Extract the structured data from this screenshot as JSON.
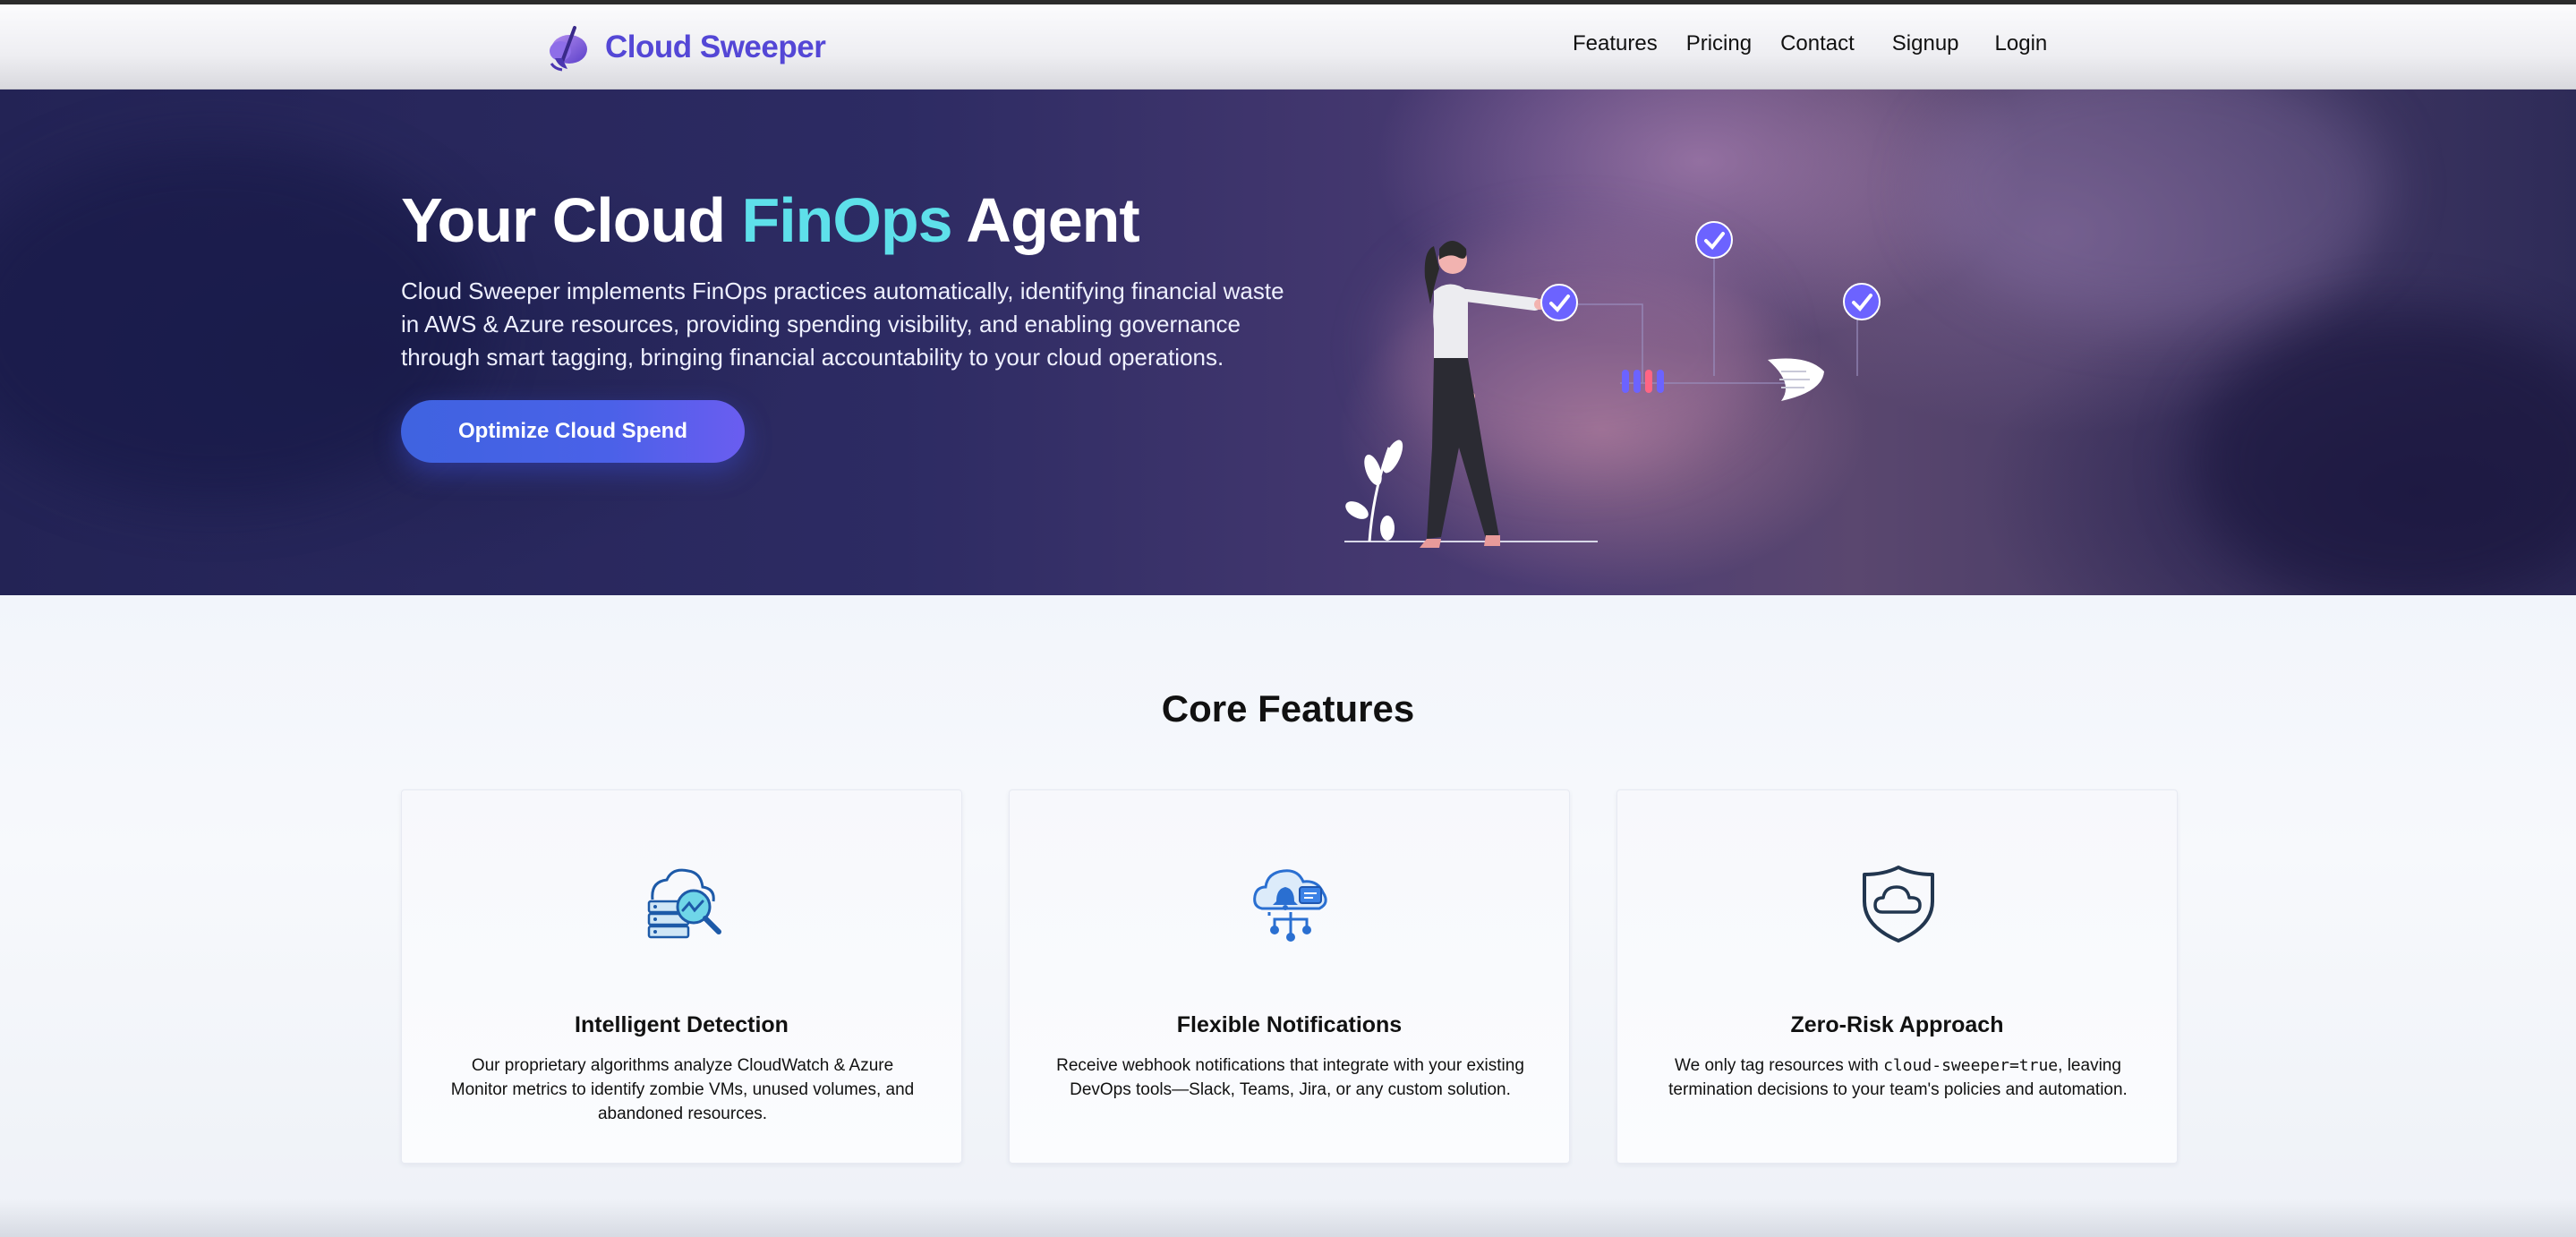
{
  "brand": {
    "name": "Cloud Sweeper",
    "logo_icon": "broom-cloud-icon",
    "color": "#5447d6"
  },
  "nav": {
    "links": [
      "Features",
      "Pricing",
      "Contact"
    ],
    "signup": "Signup",
    "login": "Login"
  },
  "hero": {
    "title_part1": "Your Cloud ",
    "title_accent": "FinOps",
    "title_part2": " Agent",
    "description": "Cloud Sweeper implements FinOps practices automatically, identifying financial waste in AWS & Azure resources, providing spending visibility, and enabling governance through smart tagging, bringing financial accountability to your cloud operations.",
    "cta_label": "Optimize Cloud Spend",
    "accent_color": "#5ee0ea"
  },
  "features": {
    "title": "Core Features",
    "cards": [
      {
        "icon": "cloud-server-analytics-icon",
        "title": "Intelligent Detection",
        "description": "Our proprietary algorithms analyze CloudWatch & Azure Monitor metrics to identify zombie VMs, unused volumes, and abandoned resources."
      },
      {
        "icon": "cloud-notification-network-icon",
        "title": "Flexible Notifications",
        "description": "Receive webhook notifications that integrate with your existing DevOps tools—Slack, Teams, Jira, or any custom solution."
      },
      {
        "icon": "shield-cloud-icon",
        "title": "Zero-Risk Approach",
        "description_before": "We only tag resources with ",
        "description_code": "cloud-sweeper=true",
        "description_after": ", leaving termination decisions to your team's policies and automation."
      }
    ]
  }
}
